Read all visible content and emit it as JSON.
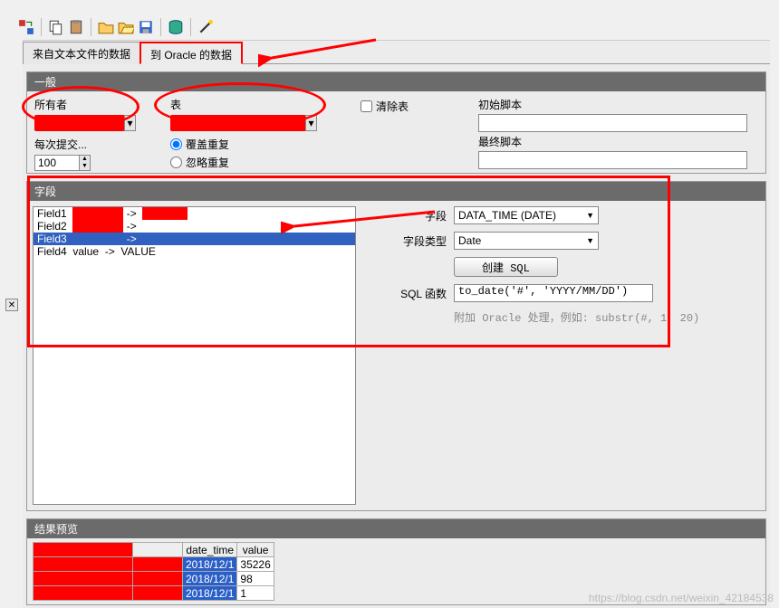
{
  "toolbar_icons": [
    "replace-icon",
    "sep",
    "copy-icon",
    "paste-icon",
    "sep",
    "folder-icon",
    "open-icon",
    "save-icon",
    "sep",
    "db-icon",
    "sep",
    "wand-icon"
  ],
  "tabs": {
    "from_text": "来自文本文件的数据",
    "to_oracle": "到 Oracle 的数据"
  },
  "sections": {
    "general": "一般",
    "fields": "字段",
    "preview": "结果预览"
  },
  "general": {
    "owner_label": "所有者",
    "table_label": "表",
    "clear_table_label": "清除表",
    "init_script_label": "初始脚本",
    "final_script_label": "最终脚本",
    "commit_every_label": "每次提交...",
    "commit_every_value": "100",
    "overwrite_label": "覆盖重复",
    "ignore_label": "忽略重复"
  },
  "fieldlist": [
    {
      "col1": "Field1",
      "col2": "",
      "arrow": "->",
      "col3": ""
    },
    {
      "col1": "Field2",
      "col2": "",
      "arrow": "->",
      "col3": ""
    },
    {
      "col1": "Field3",
      "col2": "",
      "arrow": "->",
      "col3": ""
    },
    {
      "col1": "Field4",
      "col2": "value",
      "arrow": "->",
      "col3": "VALUE"
    }
  ],
  "fieldform": {
    "field_label": "字段",
    "field_value": "DATA_TIME (DATE)",
    "type_label": "字段类型",
    "type_value": "Date",
    "create_sql_btn": "创建 SQL",
    "sqlfn_label": "SQL 函数",
    "sqlfn_value": "to_date('#', 'YYYY/MM/DD')",
    "hint": "附加 Oracle 处理，例如:  substr(#, 1, 20)"
  },
  "preview": {
    "headers": [
      "",
      "",
      "date_time",
      "value"
    ],
    "rows": [
      {
        "date_time": "2018/12/1",
        "value": "35226"
      },
      {
        "date_time": "2018/12/1",
        "value": "98"
      },
      {
        "date_time": "2018/12/1",
        "value": "1"
      }
    ]
  },
  "watermark": "https://blog.csdn.net/weixin_42184538",
  "annotations": {
    "red_ellipses": [
      {
        "target": "owner",
        "purpose": "highlight-owner-field"
      },
      {
        "target": "table",
        "purpose": "highlight-table-field"
      }
    ],
    "red_frames": [
      {
        "target": "fields-area",
        "purpose": "highlight-field-config"
      }
    ],
    "red_arrows": [
      {
        "from": "right",
        "to": "tab-to-oracle"
      },
      {
        "from": "right",
        "to": "field3-row"
      }
    ]
  }
}
